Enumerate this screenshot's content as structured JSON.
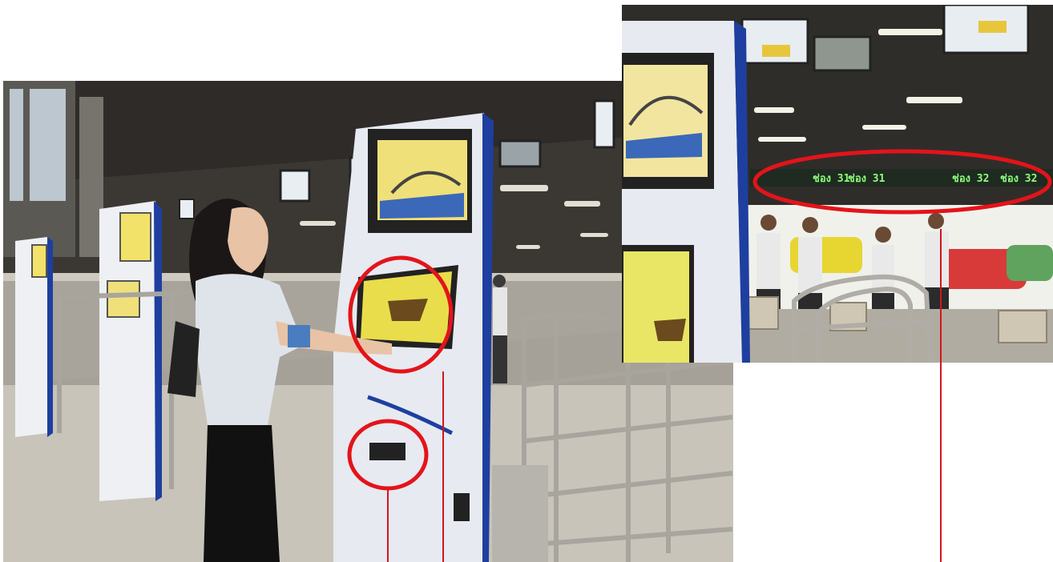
{
  "image": {
    "description_free": true,
    "colors": {
      "highlight_circle": "#e3141a",
      "callout_line": "#d4151c",
      "kiosk_body": "#e6e9ef",
      "kiosk_accent": "#1e3fa0",
      "kiosk_screen": "#e9dd4c",
      "led_text": "#8dff7a",
      "floor": "#c8c3b8",
      "ceiling": "#3a3733"
    },
    "icons": [
      "kiosk",
      "touchscreen",
      "ticket-slot",
      "led-sign",
      "railing",
      "taxi"
    ]
  },
  "inset": {
    "led_signs": [
      "ช่อง 31",
      "ช่อง 31",
      "ช่อง 32",
      "ช่อง 32"
    ]
  }
}
